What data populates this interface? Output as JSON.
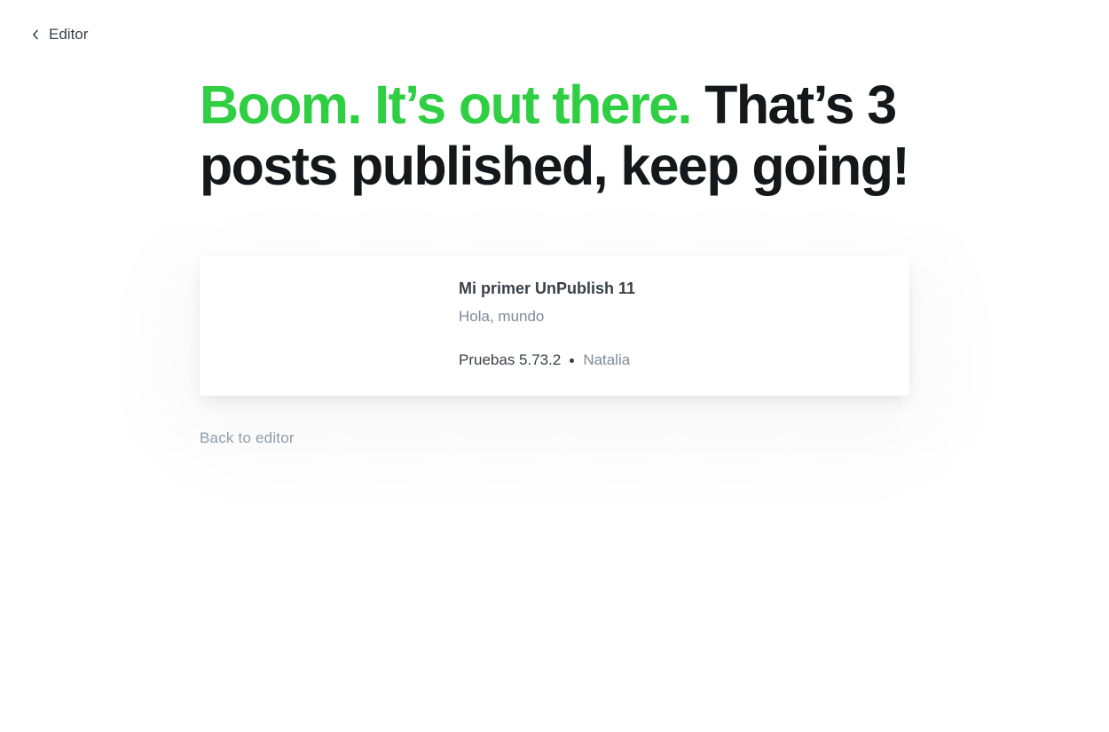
{
  "nav": {
    "back_label": "Editor",
    "back_icon": "chevron-left-icon"
  },
  "headline": {
    "accent_text": "Boom. It’s out there.",
    "rest_text": " That’s 3 posts published, keep going!",
    "accent_color": "#30cf43"
  },
  "post_card": {
    "title": "Mi primer UnPublish 11",
    "excerpt": "Hola, mundo",
    "site_name": "Pruebas 5.73.2",
    "author": "Natalia"
  },
  "footer": {
    "back_to_editor_label": "Back to editor"
  }
}
